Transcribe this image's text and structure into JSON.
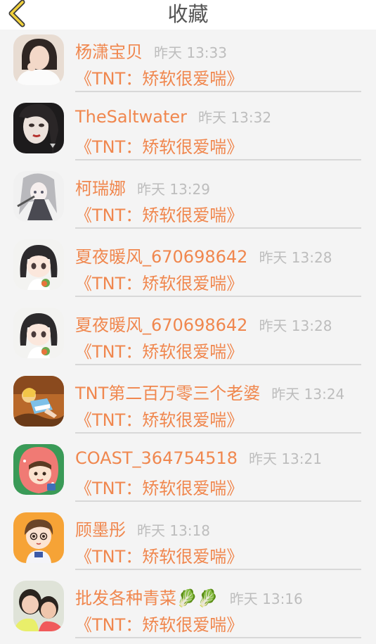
{
  "header": {
    "title": "收藏",
    "back_icon": "chevron-left-icon",
    "back_color": "#f2d23d"
  },
  "colors": {
    "accent": "#f0874e",
    "time": "#bdbdbd",
    "background": "#f4f4f4"
  },
  "favorites": [
    {
      "name": "杨潇宝贝",
      "time": "昨天 13:33",
      "message": "《TNT：矫软很爱喘》",
      "avatar": "avatar-icon-girl-white-shirt"
    },
    {
      "name": "TheSaltwater",
      "time": "昨天 13:32",
      "message": "《TNT：矫软很爱喘》",
      "avatar": "avatar-icon-girl-dark"
    },
    {
      "name": "柯瑞娜",
      "time": "昨天 13:29",
      "message": "《TNT：矫软很爱喘》",
      "avatar": "avatar-icon-anime-grey"
    },
    {
      "name": "夏夜暖风_670698642",
      "time": "昨天 13:28",
      "message": "《TNT：矫软很爱喘》",
      "avatar": "avatar-icon-anime-girl"
    },
    {
      "name": "夏夜暖风_670698642",
      "time": "昨天 13:28",
      "message": "《TNT：矫软很爱喘》",
      "avatar": "avatar-icon-anime-girl"
    },
    {
      "name": "TNT第二百万零三个老婆",
      "time": "昨天 13:24",
      "message": "《TNT：矫软很爱喘》",
      "avatar": "avatar-icon-cartoon-alice"
    },
    {
      "name": "COAST_364754518",
      "time": "昨天 13:21",
      "message": "《TNT：矫软很爱喘》",
      "avatar": "avatar-icon-cartoon-strawberry"
    },
    {
      "name": "顾墨彤",
      "time": "昨天 13:18",
      "message": "《TNT：矫软很爱喘》",
      "avatar": "avatar-icon-cartoon-boy"
    },
    {
      "name": "批发各种青菜🥬🥬",
      "time": "昨天 13:16",
      "message": "《TNT：矫软很爱喘》",
      "avatar": "avatar-icon-photo-kids"
    }
  ]
}
